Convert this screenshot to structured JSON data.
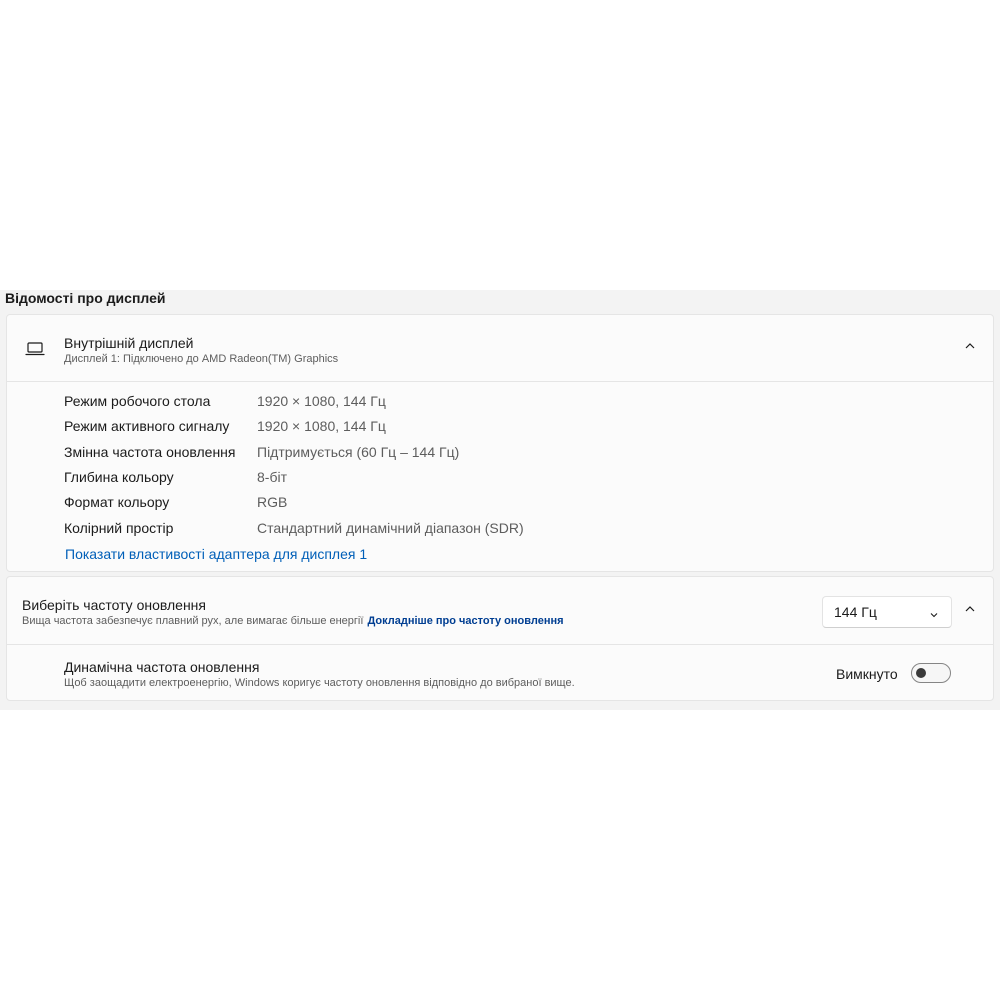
{
  "section_title": "Відомості про дисплей",
  "display": {
    "title": "Внутрішній дисплей",
    "subtitle": "Дисплей 1: Підключено до AMD Radeon(TM) Graphics",
    "icon": "laptop-icon",
    "properties": [
      {
        "label": "Режим робочого стола",
        "value": "1920 × 1080, 144 Гц"
      },
      {
        "label": "Режим активного сигналу",
        "value": "1920 × 1080, 144 Гц"
      },
      {
        "label": "Змінна частота оновлення",
        "value": "Підтримується (60 Гц – 144 Гц)"
      },
      {
        "label": "Глибина кольору",
        "value": "8-біт"
      },
      {
        "label": "Формат кольору",
        "value": "RGB"
      },
      {
        "label": "Колірний простір",
        "value": "Стандартний динамічний діапазон (SDR)"
      }
    ],
    "adapter_link": "Показати властивості адаптера для дисплея 1"
  },
  "refresh_rate": {
    "title": "Виберіть частоту оновлення",
    "subtitle": "Вища частота забезпечує плавний рух, але вимагає більше енергії",
    "learn_more_link": "Докладніше про частоту оновлення",
    "selected": "144 Гц"
  },
  "dynamic_refresh": {
    "title": "Динамічна частота оновлення",
    "subtitle": "Щоб заощадити електроенергію, Windows коригує частоту оновлення відповідно до вибраної вище.",
    "state_label": "Вимкнуто",
    "enabled": false
  },
  "colors": {
    "panel_bg": "#f3f3f3",
    "card_bg": "#fbfbfb",
    "link": "#005fb8",
    "link_bold": "#003e92"
  }
}
